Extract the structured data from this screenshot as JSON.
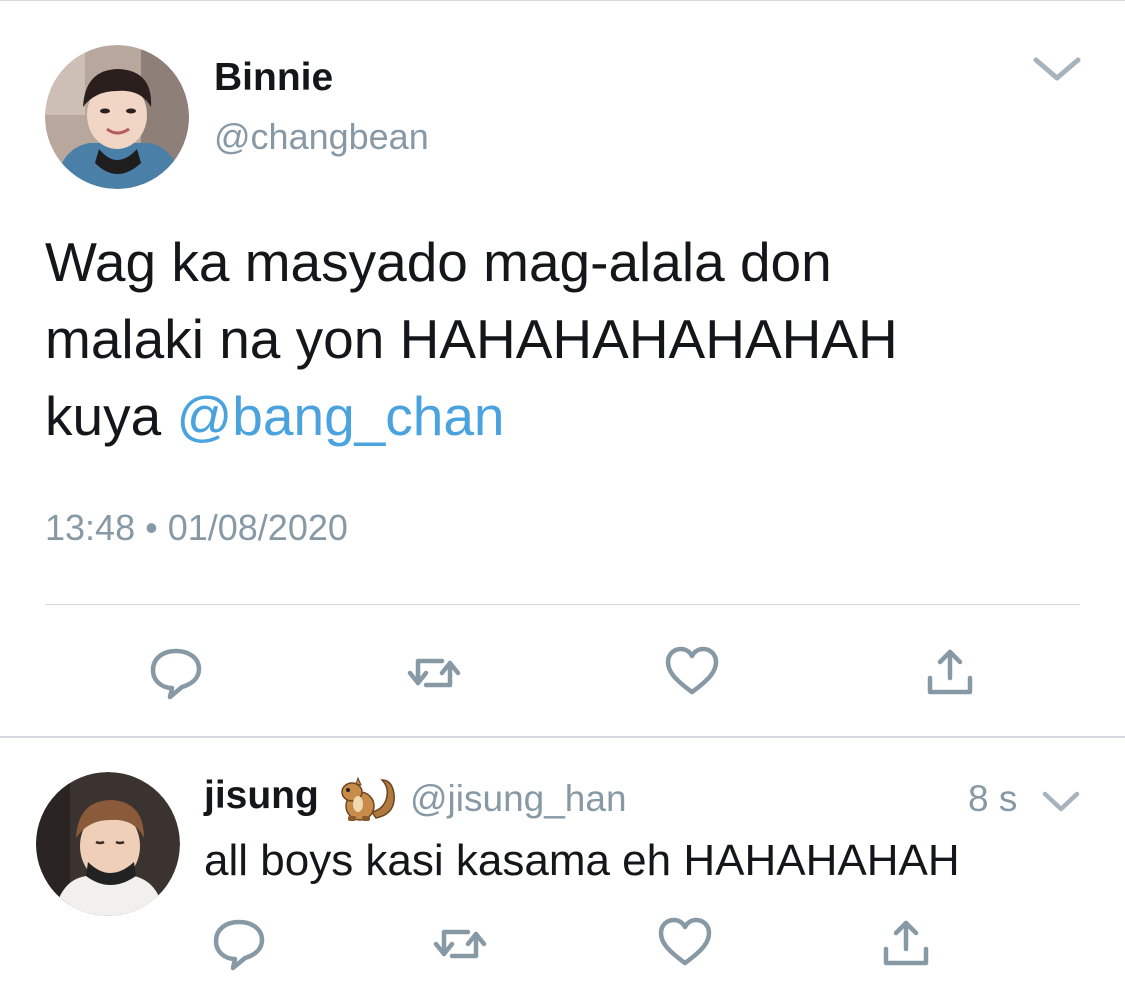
{
  "tweet": {
    "author": {
      "display_name": "Binnie",
      "handle": "@changbean",
      "avatar_icon": "profile-photo"
    },
    "text_lines": [
      "Wag ka masyado mag-alala don",
      "malaki na yon HAHAHAHAHAHAH"
    ],
    "text_prefix_line3": "kuya ",
    "mention": "@bang_chan",
    "time": "13:48",
    "separator": "•",
    "date": "01/08/2020",
    "actions": [
      "reply-icon",
      "retweet-icon",
      "like-icon",
      "share-icon"
    ]
  },
  "reply": {
    "author": {
      "display_name": "jisung",
      "emoji_icon": "chipmunk-emoji",
      "handle": "@jisung_han",
      "avatar_icon": "profile-photo"
    },
    "time_ago": "8 s",
    "text": "all boys kasi kasama eh HAHAHAHAH",
    "actions": [
      "reply-icon",
      "retweet-icon",
      "like-icon",
      "share-icon"
    ]
  },
  "colors": {
    "text": "#14171a",
    "secondary": "#8899a6",
    "mention": "#4aa3df",
    "divider": "#d5d9dd"
  }
}
